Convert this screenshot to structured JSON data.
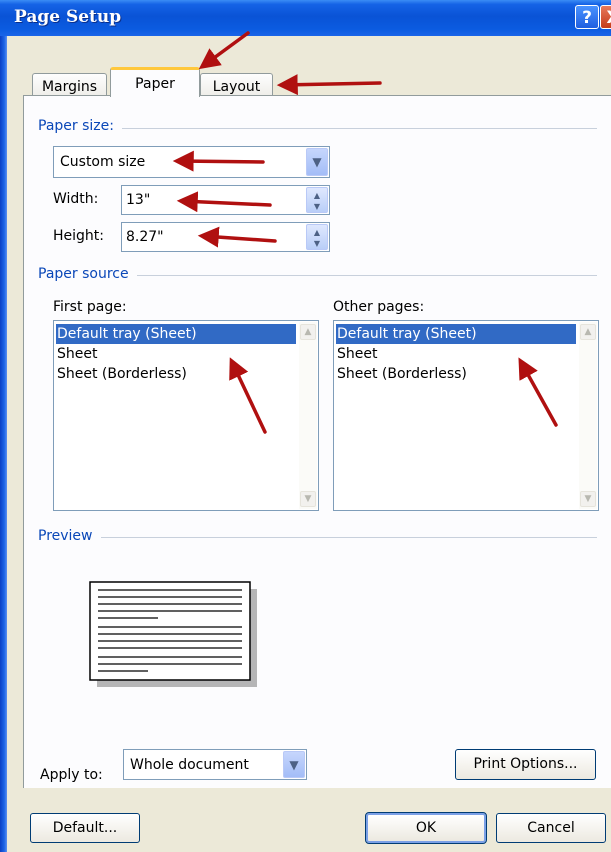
{
  "window": {
    "title": "Page Setup",
    "help_glyph": "?",
    "close_glyph": "X"
  },
  "tabs": [
    {
      "label": "Margins",
      "selected": false
    },
    {
      "label": "Paper",
      "selected": true
    },
    {
      "label": "Layout",
      "selected": false
    }
  ],
  "paper_size": {
    "section_label": "Paper size:",
    "selected": "Custom size",
    "width_label": "Width:",
    "width_value": "13\"",
    "height_label": "Height:",
    "height_value": "8.27\""
  },
  "paper_source": {
    "section_label": "Paper source",
    "first_page": {
      "label": "First page:",
      "items": [
        "Default tray (Sheet)",
        "Sheet",
        "Sheet (Borderless)"
      ],
      "selected_index": 0
    },
    "other_pages": {
      "label": "Other pages:",
      "items": [
        "Default tray (Sheet)",
        "Sheet",
        "Sheet (Borderless)"
      ],
      "selected_index": 0
    }
  },
  "preview": {
    "section_label": "Preview"
  },
  "apply_to": {
    "label": "Apply to:",
    "value": "Whole document"
  },
  "buttons": {
    "print_options": "Print Options...",
    "default": "Default...",
    "ok": "OK",
    "cancel": "Cancel"
  },
  "colors": {
    "title_bar": "#0a53d6",
    "tab_highlight": "#ffc83c",
    "section_text": "#0a47b8",
    "selection": "#316ac5",
    "annotation_arrow": "#b01010"
  }
}
